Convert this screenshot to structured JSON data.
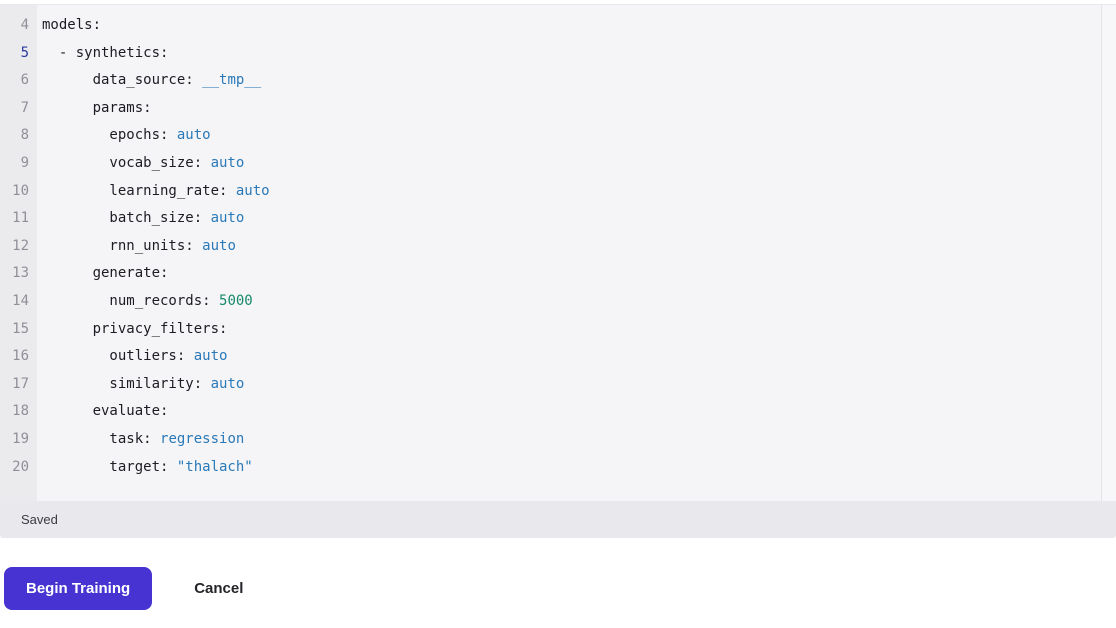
{
  "editor": {
    "language": "yaml",
    "active_line": 5,
    "lines": [
      {
        "number": 4,
        "tokens": [
          {
            "text": "models:",
            "type": "plain"
          }
        ]
      },
      {
        "number": 5,
        "tokens": [
          {
            "text": "  - synthetics:",
            "type": "plain"
          }
        ]
      },
      {
        "number": 6,
        "tokens": [
          {
            "text": "      data_source: ",
            "type": "plain"
          },
          {
            "text": "__tmp__",
            "type": "value"
          }
        ]
      },
      {
        "number": 7,
        "tokens": [
          {
            "text": "      params:",
            "type": "plain"
          }
        ]
      },
      {
        "number": 8,
        "tokens": [
          {
            "text": "        epochs: ",
            "type": "plain"
          },
          {
            "text": "auto",
            "type": "value"
          }
        ]
      },
      {
        "number": 9,
        "tokens": [
          {
            "text": "        vocab_size: ",
            "type": "plain"
          },
          {
            "text": "auto",
            "type": "value"
          }
        ]
      },
      {
        "number": 10,
        "tokens": [
          {
            "text": "        learning_rate: ",
            "type": "plain"
          },
          {
            "text": "auto",
            "type": "value"
          }
        ]
      },
      {
        "number": 11,
        "tokens": [
          {
            "text": "        batch_size: ",
            "type": "plain"
          },
          {
            "text": "auto",
            "type": "value"
          }
        ]
      },
      {
        "number": 12,
        "tokens": [
          {
            "text": "        rnn_units: ",
            "type": "plain"
          },
          {
            "text": "auto",
            "type": "value"
          }
        ]
      },
      {
        "number": 13,
        "tokens": [
          {
            "text": "      generate:",
            "type": "plain"
          }
        ]
      },
      {
        "number": 14,
        "tokens": [
          {
            "text": "        num_records: ",
            "type": "plain"
          },
          {
            "text": "5000",
            "type": "number"
          }
        ]
      },
      {
        "number": 15,
        "tokens": [
          {
            "text": "      privacy_filters:",
            "type": "plain"
          }
        ]
      },
      {
        "number": 16,
        "tokens": [
          {
            "text": "        outliers: ",
            "type": "plain"
          },
          {
            "text": "auto",
            "type": "value"
          }
        ]
      },
      {
        "number": 17,
        "tokens": [
          {
            "text": "        similarity: ",
            "type": "plain"
          },
          {
            "text": "auto",
            "type": "value"
          }
        ]
      },
      {
        "number": 18,
        "tokens": [
          {
            "text": "      evaluate:",
            "type": "plain"
          }
        ]
      },
      {
        "number": 19,
        "tokens": [
          {
            "text": "        task: ",
            "type": "plain"
          },
          {
            "text": "regression",
            "type": "value"
          }
        ]
      },
      {
        "number": 20,
        "tokens": [
          {
            "text": "        target: ",
            "type": "plain"
          },
          {
            "text": "\"thalach\"",
            "type": "string"
          }
        ]
      }
    ],
    "status_bar": {
      "text": "Saved"
    }
  },
  "actions": {
    "begin_training_label": "Begin Training",
    "cancel_label": "Cancel"
  },
  "colors": {
    "accent": "#4733d1",
    "token_value": "#2a79b8",
    "token_string": "#2a79b8",
    "token_number": "#17896a",
    "active_line_number": "#2b3a9e",
    "editor_bg": "#f5f5f7",
    "gutter_bg": "#ebebee",
    "status_bar_bg": "#e9e9ed"
  }
}
